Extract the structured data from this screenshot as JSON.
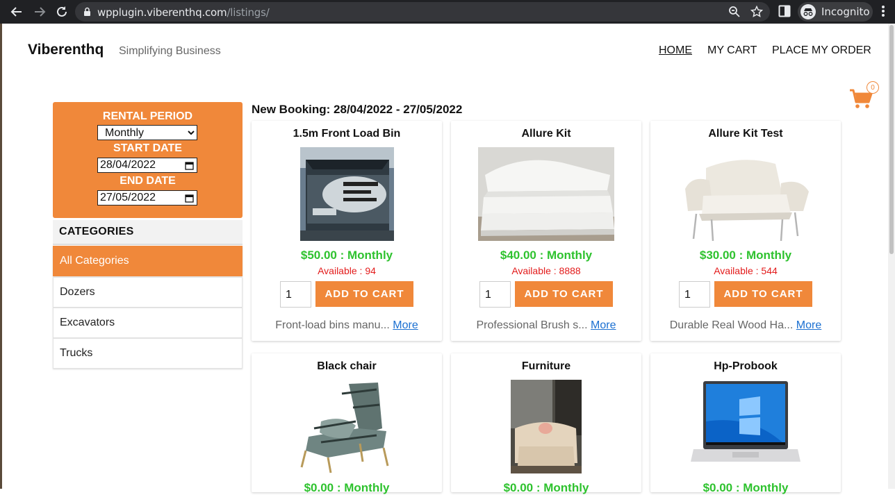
{
  "browser": {
    "url_host": "wpplugin.viberenthq.com",
    "url_path": "/listings/",
    "profile_label": "Incognito"
  },
  "header": {
    "brand": "Viberenthq",
    "tagline": "Simplifying Business",
    "nav": {
      "home": "HOME",
      "cart": "MY CART",
      "order": "PLACE MY ORDER"
    },
    "cart_count": "0"
  },
  "rental": {
    "period_label": "RENTAL PERIOD",
    "period_value": "Monthly",
    "start_label": "START DATE",
    "start_value": "28/04/2022",
    "end_label": "END DATE",
    "end_value": "27/05/2022"
  },
  "categories": {
    "heading": "CATEGORIES",
    "items": [
      "All Categories",
      "Dozers",
      "Excavators",
      "Trucks"
    ]
  },
  "booking_title": "New Booking: 28/04/2022 - 27/05/2022",
  "add_label": "ADD TO CART",
  "more_label": "More",
  "products": [
    {
      "title": "1.5m Front Load Bin",
      "price": "$50.00 : Monthly",
      "available": "Available : 94",
      "qty": "1",
      "desc": "Front-load bins manu..."
    },
    {
      "title": "Allure Kit",
      "price": "$40.00 : Monthly",
      "available": "Available : 8888",
      "qty": "1",
      "desc": "Professional Brush s..."
    },
    {
      "title": "Allure Kit Test",
      "price": "$30.00 : Monthly",
      "available": "Available : 544",
      "qty": "1",
      "desc": "Durable Real Wood Ha..."
    },
    {
      "title": "Black chair",
      "price": "$0.00 : Monthly"
    },
    {
      "title": "Furniture",
      "price": "$0.00 : Monthly"
    },
    {
      "title": "Hp-Probook",
      "price": "$0.00 : Monthly"
    }
  ],
  "colors": {
    "accent": "#f0883a",
    "price": "#2ec22e",
    "available": "#e31b1b",
    "link": "#1a6fd1"
  }
}
